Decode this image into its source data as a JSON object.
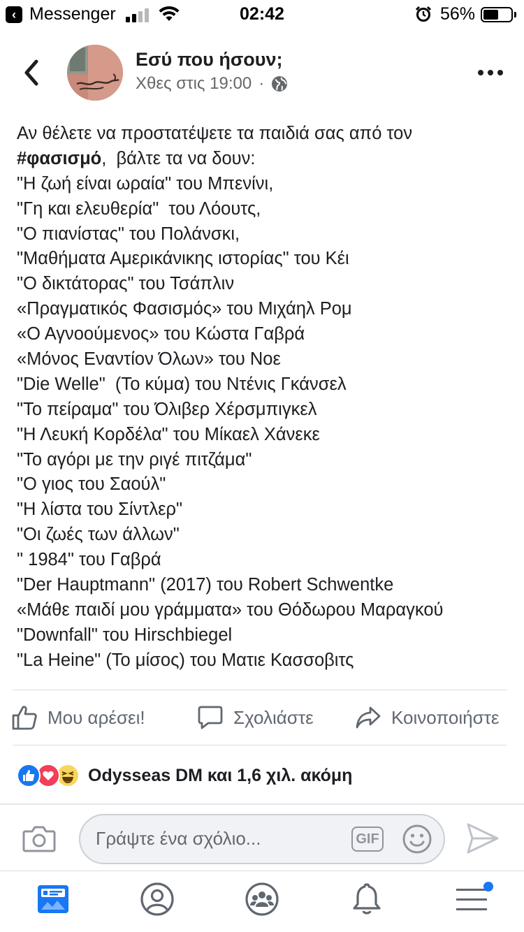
{
  "status_bar": {
    "back_app": "Messenger",
    "time": "02:42",
    "battery_percent": "56%",
    "battery_level": 0.56,
    "signal_bars": 2
  },
  "post": {
    "author": "Εσύ που ήσουν;",
    "timestamp": "Χθες στις 19:00",
    "meta_separator": "·",
    "body_lines": [
      {
        "before": "Αν θέλετε να προστατέψετε τα παιδιά σας από τον",
        "hashtag": "",
        "after": ""
      },
      {
        "before": "",
        "hashtag": "#φασισμό",
        "after": ",  βάλτε τα να δουν:"
      },
      {
        "before": "\"Η ζωή είναι ωραία\" του Μπενίνι,",
        "hashtag": "",
        "after": ""
      },
      {
        "before": "\"Γη και ελευθερία\"  του Λόουτς,",
        "hashtag": "",
        "after": ""
      },
      {
        "before": "\"Ο πιανίστας\" του Πολάνσκι,",
        "hashtag": "",
        "after": ""
      },
      {
        "before": "\"Μαθήματα Αμερικάνικης ιστορίας\" του Κέι",
        "hashtag": "",
        "after": ""
      },
      {
        "before": "\"Ο δικτάτορας\" του Τσάπλιν",
        "hashtag": "",
        "after": ""
      },
      {
        "before": "«Πραγματικός Φασισμός» του Μιχάηλ Ρομ",
        "hashtag": "",
        "after": ""
      },
      {
        "before": "«Ο Αγνοούμενος» του Κώστα Γαβρά",
        "hashtag": "",
        "after": ""
      },
      {
        "before": "«Μόνος Εναντίον Όλων» του Νοε",
        "hashtag": "",
        "after": ""
      },
      {
        "before": "\"Die Welle\"  (Το κύμα) του Ντένις Γκάνσελ",
        "hashtag": "",
        "after": ""
      },
      {
        "before": "\"Το πείραμα\" του Όλιβερ Χέρσμπιγκελ",
        "hashtag": "",
        "after": ""
      },
      {
        "before": "\"Η Λευκή Κορδέλα\" του Μίκαελ Χάνεκε",
        "hashtag": "",
        "after": ""
      },
      {
        "before": "\"Το αγόρι με την ριγέ πιτζάμα\"",
        "hashtag": "",
        "after": ""
      },
      {
        "before": "\"Ο γιος του Σαούλ\"",
        "hashtag": "",
        "after": ""
      },
      {
        "before": "\"Η λίστα του Σίντλερ\"",
        "hashtag": "",
        "after": ""
      },
      {
        "before": "\"Οι ζωές των άλλων\"",
        "hashtag": "",
        "after": ""
      },
      {
        "before": "\" 1984\" του Γαβρά",
        "hashtag": "",
        "after": ""
      },
      {
        "before": "\"Der Hauptmann\" (2017) του Robert Schwentke",
        "hashtag": "",
        "after": ""
      },
      {
        "before": "«Μάθε παιδί μου γράμματα» του Θόδωρου Μαραγκού",
        "hashtag": "",
        "after": ""
      },
      {
        "before": "\"Downfall\" του Hirschbiegel",
        "hashtag": "",
        "after": ""
      },
      {
        "before": "\"La Heine\" (Το μίσος) του Ματιε Κασσοβιτς",
        "hashtag": "",
        "after": ""
      }
    ]
  },
  "actions": {
    "like": "Μου αρέσει!",
    "comment": "Σχολιάστε",
    "share": "Κοινοποιήστε"
  },
  "reactions": {
    "summary": "Odysseas DM και 1,6 χιλ. ακόμη",
    "types": [
      "like",
      "love",
      "haha"
    ]
  },
  "composer": {
    "placeholder": "Γράψτε ένα σχόλιο...",
    "gif_label": "GIF"
  },
  "bottom_nav": {
    "items": [
      "news-feed",
      "profile",
      "groups",
      "notifications",
      "menu"
    ],
    "accent_color": "#1877f2"
  }
}
